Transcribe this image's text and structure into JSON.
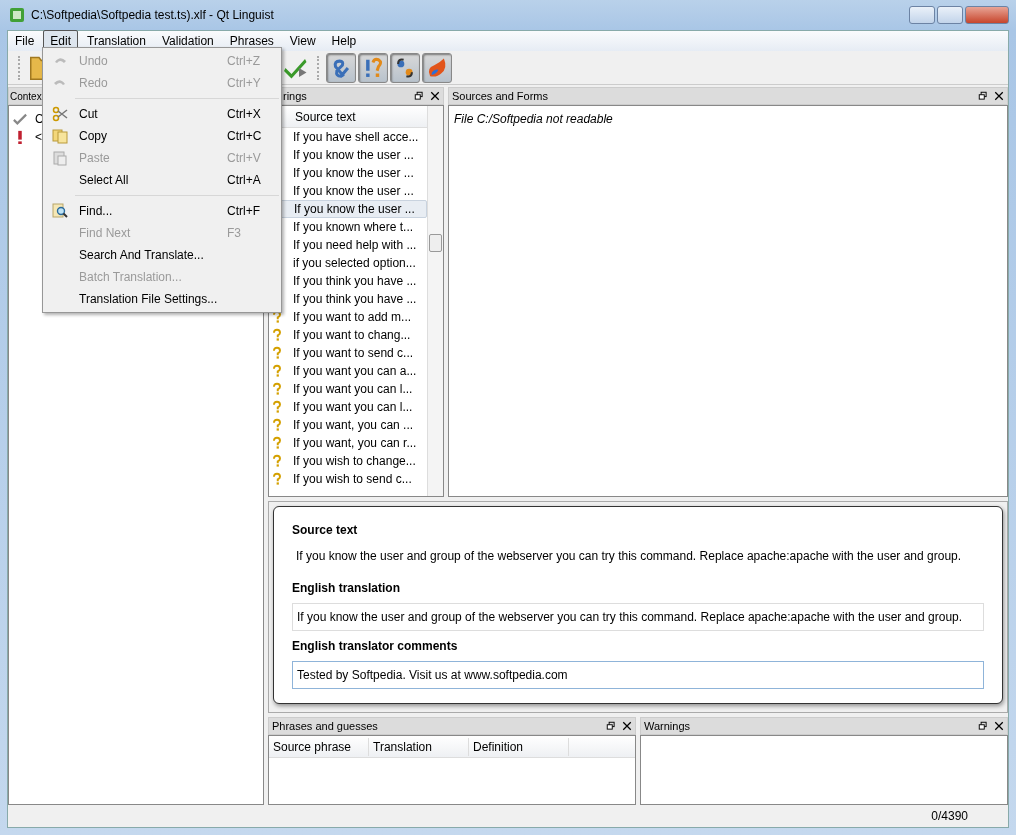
{
  "window": {
    "title": "C:\\Softpedia\\Softpedia test.ts).xlf - Qt Linguist"
  },
  "menubar": [
    {
      "label": "File",
      "selected": false
    },
    {
      "label": "Edit",
      "selected": true
    },
    {
      "label": "Translation",
      "selected": false
    },
    {
      "label": "Validation",
      "selected": false
    },
    {
      "label": "Phrases",
      "selected": false
    },
    {
      "label": "View",
      "selected": false
    },
    {
      "label": "Help",
      "selected": false
    }
  ],
  "edit_menu": [
    {
      "kind": "item",
      "label": "Undo",
      "shortcut": "Ctrl+Z",
      "disabled": true
    },
    {
      "kind": "item",
      "label": "Redo",
      "shortcut": "Ctrl+Y",
      "disabled": true
    },
    {
      "kind": "separator"
    },
    {
      "kind": "item",
      "label": "Cut",
      "shortcut": "Ctrl+X",
      "disabled": false
    },
    {
      "kind": "item",
      "label": "Copy",
      "shortcut": "Ctrl+C",
      "disabled": false
    },
    {
      "kind": "item",
      "label": "Paste",
      "shortcut": "Ctrl+V",
      "disabled": true
    },
    {
      "kind": "item",
      "label": "Select All",
      "shortcut": "Ctrl+A",
      "disabled": false
    },
    {
      "kind": "separator"
    },
    {
      "kind": "item",
      "label": "Find...",
      "shortcut": "Ctrl+F",
      "disabled": false
    },
    {
      "kind": "item",
      "label": "Find Next",
      "shortcut": "F3",
      "disabled": true
    },
    {
      "kind": "item",
      "label": "Search And Translate...",
      "disabled": false
    },
    {
      "kind": "item",
      "label": "Batch Translation...",
      "disabled": true
    },
    {
      "kind": "item",
      "label": "Translation File Settings...",
      "disabled": false
    }
  ],
  "toolbar": {
    "validation_buttons": [
      {
        "checked": true
      },
      {
        "checked": true
      },
      {
        "checked": true
      },
      {
        "checked": true
      }
    ]
  },
  "context_panel": {
    "title": "Contex",
    "rows": [
      {
        "kind": "done",
        "text": "C"
      },
      {
        "kind": "warning",
        "text": "<"
      }
    ]
  },
  "strings_panel": {
    "title": "rings",
    "column": "Source text",
    "rows": [
      {
        "text": "If you have shell acce...",
        "selected": false
      },
      {
        "text": "If you know the user ...",
        "selected": false
      },
      {
        "text": "If you know the user ...",
        "selected": false
      },
      {
        "text": "If you know the user ...",
        "selected": false
      },
      {
        "text": "If you know the user ...",
        "selected": true
      },
      {
        "text": "If you known where t...",
        "selected": false
      },
      {
        "text": "If you need help with ...",
        "selected": false
      },
      {
        "text": "if you selected option...",
        "selected": false
      },
      {
        "text": "If you think you have ...",
        "selected": false
      },
      {
        "text": "If you think you have ...",
        "selected": false
      },
      {
        "text": "If you want to add m...",
        "selected": false,
        "kind": "unsure"
      },
      {
        "text": "If you want to chang...",
        "selected": false,
        "kind": "unsure"
      },
      {
        "text": "If you want to send c...",
        "selected": false,
        "kind": "unsure"
      },
      {
        "text": "If you want you can a...",
        "selected": false,
        "kind": "unsure"
      },
      {
        "text": "If you want you can l...",
        "selected": false,
        "kind": "unsure"
      },
      {
        "text": "If you want you can l...",
        "selected": false,
        "kind": "unsure"
      },
      {
        "text": "If you want, you can ...",
        "selected": false,
        "kind": "unsure"
      },
      {
        "text": "If you want, you can r...",
        "selected": false,
        "kind": "unsure"
      },
      {
        "text": "If you wish to change...",
        "selected": false,
        "kind": "unsure"
      },
      {
        "text": "If you wish to send c...",
        "selected": false,
        "kind": "unsure"
      }
    ]
  },
  "sources_panel": {
    "title": "Sources and Forms",
    "message": "File C:/Softpedia not readable"
  },
  "editor": {
    "source_label": "Source text",
    "source_text": "If you know the user and group of the webserver you can try this command. Replace apache:apache with the user and group.",
    "translation_label": "English translation",
    "translation": "If you know the user and group of the webserver you can try this command. Replace apache:apache with the user and group.",
    "comments_label": "English translator comments",
    "comments": "Tested by Softpedia. Visit us at www.softpedia.com"
  },
  "phrases_panel": {
    "title": "Phrases and guesses",
    "columns": [
      "Source phrase",
      "Translation",
      "Definition"
    ]
  },
  "warnings_panel": {
    "title": "Warnings"
  },
  "status_bar": {
    "count": "0/4390"
  }
}
